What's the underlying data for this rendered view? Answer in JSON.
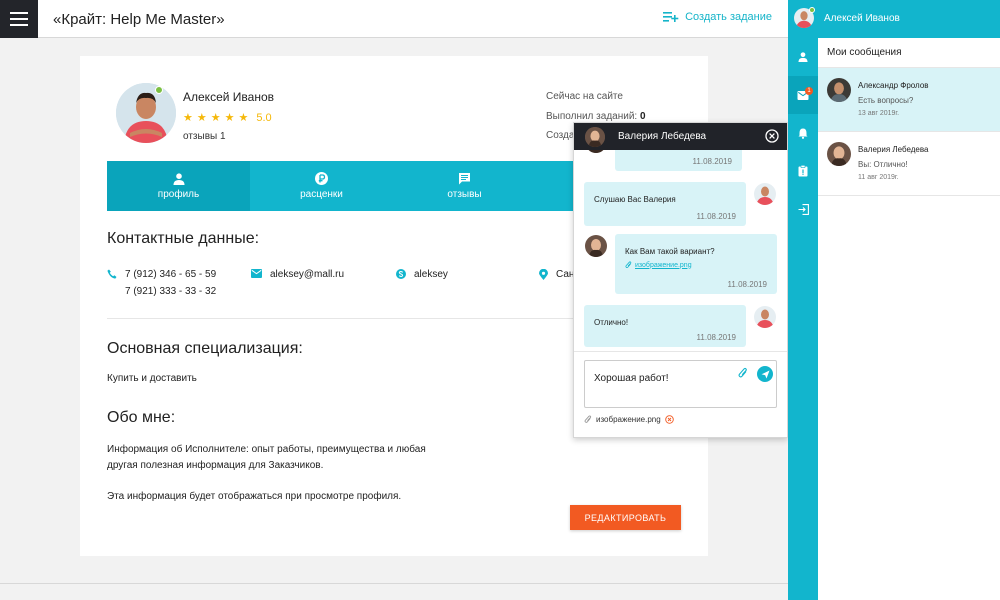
{
  "header": {
    "title": "«Крайт: Help Me Master»",
    "create_task": "Создать задание"
  },
  "profile": {
    "name": "Алексей Иванов",
    "rating": "5.0",
    "reviews": "отзывы 1",
    "stat_online": "Сейчас на сайте",
    "stat_done_label": "Выполнил заданий:",
    "stat_done_value": "0",
    "stat_created": "Созда"
  },
  "tabs": [
    {
      "label": "профиль",
      "icon": "person-icon",
      "active": true
    },
    {
      "label": "расценки",
      "icon": "ruble-icon",
      "active": false
    },
    {
      "label": "отзывы",
      "icon": "comment-icon",
      "active": false
    }
  ],
  "contacts": {
    "heading": "Контактные данные:",
    "phone1": "7 (912) 346 - 65 - 59",
    "phone2": "7 (921) 333 - 33 - 32",
    "email": "aleksey@mall.ru",
    "skype": "aleksey",
    "location": "Сан"
  },
  "specialization": {
    "heading": "Основная специализация:",
    "text": "Купить и доставить"
  },
  "about": {
    "heading": "Обо мне:",
    "line1": "Информация об Исполнителе: опыт работы, преимущества и любая",
    "line2": "другая полезная информация для Заказчиков.",
    "line3": "Эта информация будет отображаться при просмотре профиля."
  },
  "edit_button": "РЕДАКТИРОВАТЬ",
  "chat": {
    "title": "Валерия Лебедева",
    "messages": [
      {
        "text": "",
        "date": "11.08.2019",
        "from": "other"
      },
      {
        "text": "Слушаю Вас Валерия",
        "date": "11.08.2019",
        "from": "me"
      },
      {
        "text": "Как Вам такой вариант?",
        "attachment": "изображение.png",
        "date": "11.08.2019",
        "from": "other"
      },
      {
        "text": "Отлично!",
        "date": "11.08.2019",
        "from": "me"
      }
    ],
    "reply_text": "Хорошая работ!",
    "attached_file": "изображение.png"
  },
  "sidebar": {
    "user_name": "Алексей Иванов",
    "panel_title": "Мои сообщения",
    "unread_badge": "1",
    "conversations": [
      {
        "name": "Александр Фролов",
        "preview": "Есть вопросы?",
        "date": "13 авг 2019г."
      },
      {
        "name": "Валерия Лебедева",
        "preview": "Вы: Отлично!",
        "date": "11 авг 2019г."
      }
    ]
  },
  "colors": {
    "accent": "#12b5cd",
    "accent_dark": "#0aa4bb",
    "dark": "#23252a",
    "button": "#f25a22",
    "star": "#f5b80a",
    "online": "#7cc042",
    "bubble": "#d8f3f7"
  }
}
